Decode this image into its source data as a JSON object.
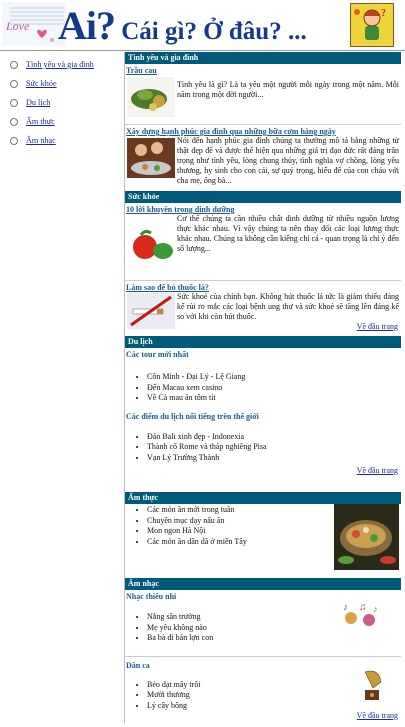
{
  "header": {
    "title_big": "Ai?",
    "title_rest": " Cái gì? Ở đâu? ...",
    "logo_text": "Love"
  },
  "sidebar": {
    "items": [
      {
        "label": "Tình yêu và gia đình"
      },
      {
        "label": "Sức khỏe"
      },
      {
        "label": "Du lịch"
      },
      {
        "label": "Ẩm thực"
      },
      {
        "label": "Âm nhạc"
      }
    ]
  },
  "sections": {
    "love": {
      "heading": "Tình yêu và gia đình",
      "a1_title": "Trầu cau",
      "a1_text": "Tình yêu là gì? Là ta yêu một người mỗi ngày trong một năm. Mỗi năm trong một đời người...",
      "a2_title": "Xây dựng hạnh phúc gia đình qua những bữa cơm hàng ngày",
      "a2_text": "Nói đến hạnh phúc gia đình chúng ta thường mô tả bằng những từ thật đẹp để và được thể hiện qua những giá trị đạo đức rất đáng trân trọng như tình yêu, lòng chung thủy, tình nghĩa vợ chồng, lòng yêu thương, hy sinh cho con cái, sự quý trọng, hiếu để của con cháu với cha mẹ, ông bà..."
    },
    "health": {
      "heading": "Sức khỏe",
      "a1_title": "10 lời khuyên trong dinh dưỡng",
      "a1_text": "Cơ thể chúng ta cần nhiều chất dinh dưỡng từ nhiều nguồn lương thực khác nhau. Vì vậy chúng ta nên thay đổi các loại lương thực khác nhau. Chúng ta không cần kiêng chỉ cả - quan trọng là chỉ ý đến số lượng...",
      "a2_title": "Làm sao để bỏ thuốc lá?",
      "a2_text": "Sức khoẻ của chính bạn. Không hút thuốc lá tức là giảm thiểu đáng kể rủi ro mắc các loại bệnh ung thư và sức khoẻ sẽ tăng lên đáng kể so với khi còn hút thuốc.",
      "back": "Về đầu trang"
    },
    "travel": {
      "heading": "Du lịch",
      "sub1": "Các tour mới nhất",
      "list1": [
        "Côn Minh - Đại Lý - Lệ Giang",
        "Đến Macau xem casino",
        "Về Cà mau ăn tôm tít"
      ],
      "sub2": "Các điểm du lịch nổi tiếng trên thế giới",
      "list2": [
        "Đảo Bali xinh đẹp - Indonexia",
        "Thành cổ Rome và tháp nghiêng Pisa",
        "Vạn Lý Trường Thành"
      ],
      "back": "Về đầu trang"
    },
    "food": {
      "heading": "Ẩm thực",
      "list": [
        "Các món ăn mới trong tuần",
        "Chuyên mục dạy nấu ăn",
        "Mon ngon Hà Nội",
        "Các món ăn dân dã ở miền Tây"
      ]
    },
    "music": {
      "heading": "Âm nhạc",
      "sub1": "Nhạc thiếu nhi",
      "list1": [
        "Nắng sân trường",
        "Mẹ yêu không nào",
        "Ba bà đi bán lợn con"
      ],
      "sub2": "Dân ca",
      "list2": [
        "Bèo dạt mây trôi",
        "Mười thương",
        "Lý cây bông"
      ],
      "back": "Về đầu trang"
    }
  },
  "colors": {
    "section_header": "#005a7a",
    "title_blue": "#163a8a",
    "article_title": "#1a5a8f",
    "link": "#1a2a9a"
  }
}
